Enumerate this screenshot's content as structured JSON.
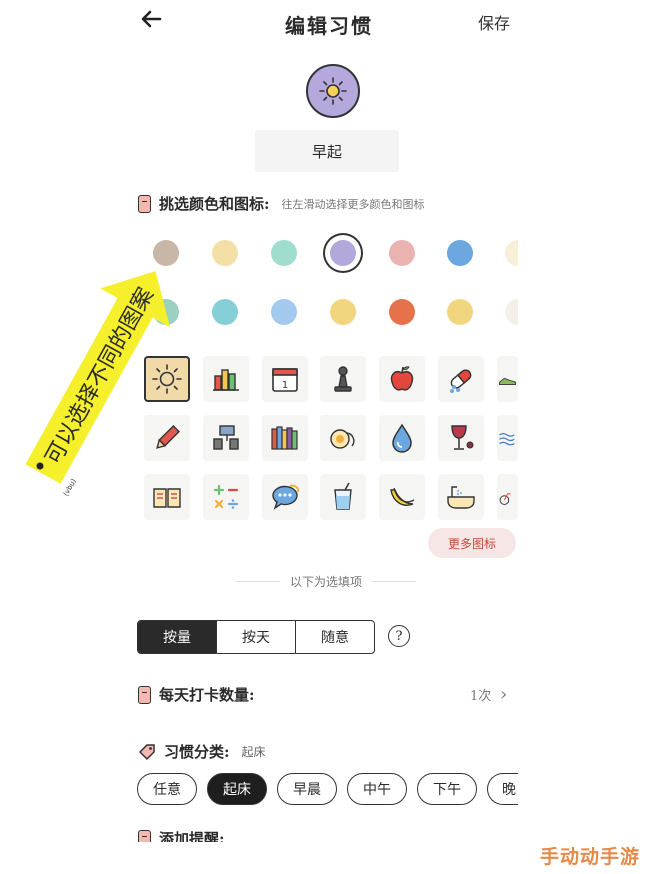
{
  "header": {
    "title": "编辑习惯",
    "save_label": "保存"
  },
  "habit_name": "早起",
  "picker": {
    "label": "挑选颜色和图标:",
    "hint": "往左滑动选择更多颜色和图标"
  },
  "colors": {
    "row1": [
      "#c8b7a6",
      "#f4dfa6",
      "#9fddcf",
      "#b3a8dc",
      "#eab3b0",
      "#6ca8df",
      "#f7efd8"
    ],
    "row2": [
      "#9ad0c2",
      "#86cfd6",
      "#a3c9ee",
      "#f1d57f",
      "#e6724b",
      "#f1d57f",
      "#f4efe8"
    ],
    "selected": "#b3a8dc"
  },
  "icons": [
    [
      "sun-icon",
      "bar-chart-icon",
      "calendar-icon",
      "pawn-icon",
      "apple-icon",
      "pills-icon",
      "shoe-icon"
    ],
    [
      "pencil-icon",
      "meeting-icon",
      "books-icon",
      "egg-icon",
      "water-drop-icon",
      "wine-icon",
      "waves-icon"
    ],
    [
      "open-book-icon",
      "math-icon",
      "chat-bubble-icon",
      "drink-cup-icon",
      "banana-icon",
      "bathtub-icon",
      "bicycle-icon"
    ]
  ],
  "more_icons_label": "更多图标",
  "optional_label": "以下为选填项",
  "mode_tabs": [
    "按量",
    "按天",
    "随意"
  ],
  "mode_active": 0,
  "help_label": "?",
  "daily_count": {
    "label": "每天打卡数量:",
    "value": "1次",
    "chevron": "›"
  },
  "category": {
    "label": "习惯分类:",
    "current": "起床",
    "options": [
      "任意",
      "起床",
      "早晨",
      "中午",
      "下午",
      "晚"
    ],
    "active": 1
  },
  "reminder_label": "添加提醒:",
  "annotation": "可以选择不同的图案",
  "annotation_small": "(vbu)",
  "watermark": "手动动手游"
}
